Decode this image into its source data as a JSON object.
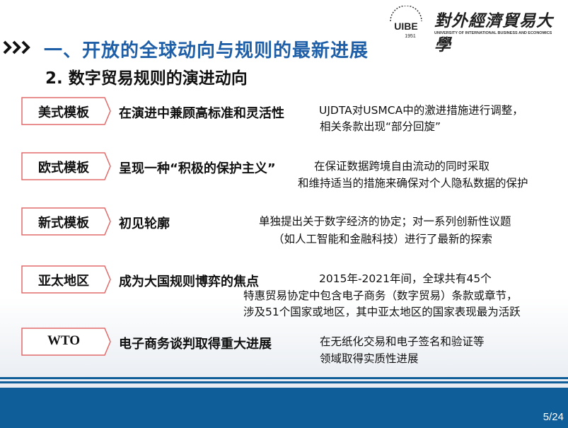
{
  "logo": {
    "seal_text": "UIBE",
    "seal_year": "1951",
    "name_cn": "對外經濟貿易大學",
    "name_en": "UNIVERSITY OF INTERNATIONAL BUSINESS AND ECONOMICS"
  },
  "title": "一、开放的全球动向与规则的最新进展",
  "subtitle": "2. 数字贸易规则的演进动向",
  "rows": [
    {
      "tag": "美式模板",
      "head": "在演进中兼顾高标准和灵活性",
      "desc": [
        "UJDTA对USMCA中的激进措施进行调整，",
        "相关条款出现“部分回旋”"
      ]
    },
    {
      "tag": "欧式模板",
      "head": "呈现一种“积极的保护主义”",
      "desc": [
        "在保证数据跨境自由流动的同时采取",
        "和维持适当的措施来确保对个人隐私数据的保护"
      ]
    },
    {
      "tag": "新式模板",
      "head": "初见轮廓",
      "desc": [
        "单独提出关于数字经济的协定；对一系列创新性议题",
        "（如人工智能和金融科技）进行了最新的探索"
      ]
    },
    {
      "tag": "亚太地区",
      "head": "成为大国规则博弈的焦点",
      "desc": [
        "2015年-2021年间，全球共有45个",
        "特惠贸易协定中包含电子商务（数字贸易）条款或章节，",
        "涉及51个国家或地区，其中亚太地区的国家表现最为活跃"
      ]
    },
    {
      "tag": "WTO",
      "head": "电子商务谈判取得重大进展",
      "desc": [
        "在无纸化交易和电子签名和验证等",
        "领域取得实质性进展"
      ]
    }
  ],
  "page_number": "5/24",
  "colors": {
    "accent": "#1f5fa8",
    "tag_border": "#e06a6a",
    "band": "#0f5e99"
  }
}
